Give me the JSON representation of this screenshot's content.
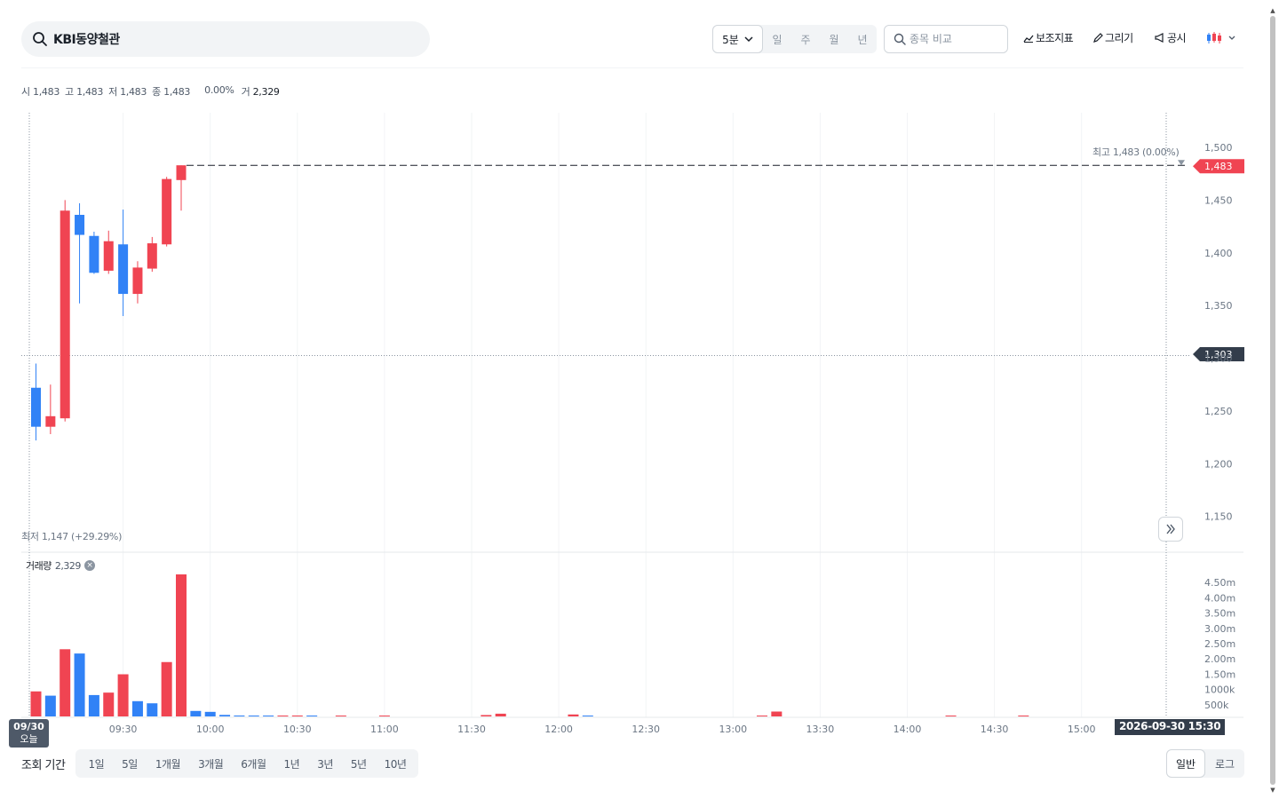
{
  "search": {
    "stock_name": "KBI동양철관"
  },
  "toolbar": {
    "interval_selected": "5분",
    "interval_options": [
      "일",
      "주",
      "월",
      "년"
    ],
    "compare_placeholder": "종목 비교",
    "indicator_label": "보조지표",
    "draw_label": "그리기",
    "disclosure_label": "공시"
  },
  "ohlc": {
    "open_label": "시",
    "open": "1,483",
    "high_label": "고",
    "high": "1,483",
    "low_label": "저",
    "low": "1,483",
    "close_label": "종",
    "close": "1,483",
    "change": "0.00%",
    "volume_label": "거",
    "volume": "2,329"
  },
  "annotations": {
    "high_text": "최고  1,483 (0.00%)",
    "low_text": "최저  1,147 (+29.29%)",
    "current_price_tag": "1,483",
    "crosshair_price_tag": "1,303"
  },
  "volume_panel": {
    "label": "거래량",
    "value": "2,329"
  },
  "date_badge": {
    "date": "09/30",
    "day": "오늘"
  },
  "timestamp_badge": "2026-09-30 15:30",
  "period": {
    "label": "조회 기간",
    "options": [
      "1일",
      "5일",
      "1개월",
      "3개월",
      "6개월",
      "1년",
      "3년",
      "5년",
      "10년"
    ]
  },
  "scale": {
    "normal": "일반",
    "log": "로그"
  },
  "colors": {
    "up": "#f04452",
    "down": "#3182f6",
    "grid": "#f2f4f6",
    "tag_bg": "#333d4b"
  },
  "chart_data": [
    {
      "type": "candlestick",
      "xlabel": "",
      "ylabel": "",
      "y_ticks": [
        1150,
        1200,
        1250,
        1300,
        1350,
        1400,
        1450,
        1500
      ],
      "y_tick_labels": [
        "1,150",
        "1,200",
        "1,250",
        "1,300",
        "1,350",
        "1,400",
        "1,450",
        "1,500"
      ],
      "x_tick_labels": [
        "09:30",
        "10:00",
        "10:30",
        "11:00",
        "11:30",
        "12:00",
        "12:30",
        "13:00",
        "13:30",
        "14:00",
        "14:30",
        "15:00"
      ],
      "ylim": [
        1120,
        1515
      ],
      "grid": true,
      "candles": [
        {
          "time": "09:00",
          "open": 1272,
          "high": 1295,
          "low": 1222,
          "close": 1235
        },
        {
          "time": "09:05",
          "open": 1235,
          "high": 1275,
          "low": 1228,
          "close": 1245
        },
        {
          "time": "09:10",
          "open": 1243,
          "high": 1450,
          "low": 1240,
          "close": 1440
        },
        {
          "time": "09:15",
          "open": 1436,
          "high": 1447,
          "low": 1352,
          "close": 1417
        },
        {
          "time": "09:20",
          "open": 1416,
          "high": 1420,
          "low": 1380,
          "close": 1381
        },
        {
          "time": "09:25",
          "open": 1383,
          "high": 1421,
          "low": 1380,
          "close": 1411
        },
        {
          "time": "09:30",
          "open": 1408,
          "high": 1441,
          "low": 1340,
          "close": 1361
        },
        {
          "time": "09:35",
          "open": 1361,
          "high": 1392,
          "low": 1352,
          "close": 1386
        },
        {
          "time": "09:40",
          "open": 1385,
          "high": 1415,
          "low": 1382,
          "close": 1409
        },
        {
          "time": "09:45",
          "open": 1408,
          "high": 1472,
          "low": 1406,
          "close": 1470
        },
        {
          "time": "09:50",
          "open": 1469,
          "high": 1483,
          "low": 1440,
          "close": 1483
        }
      ],
      "last_price": 1483,
      "high": 1483,
      "low": 1147
    },
    {
      "type": "bar",
      "title": "거래량",
      "y_tick_labels": [
        "500k",
        "1000k",
        "1.50m",
        "2.00m",
        "2.50m",
        "3.00m",
        "3.50m",
        "4.00m",
        "4.50m"
      ],
      "y_ticks": [
        500000,
        1000000,
        1500000,
        2000000,
        2500000,
        3000000,
        3500000,
        4000000,
        4500000
      ],
      "ylim": [
        0,
        4700000
      ],
      "bars": [
        {
          "time": "09:00",
          "value": 820000,
          "direction": "up"
        },
        {
          "time": "09:05",
          "value": 680000,
          "direction": "down"
        },
        {
          "time": "09:10",
          "value": 2200000,
          "direction": "up"
        },
        {
          "time": "09:15",
          "value": 2060000,
          "direction": "down"
        },
        {
          "time": "09:20",
          "value": 700000,
          "direction": "down"
        },
        {
          "time": "09:25",
          "value": 780000,
          "direction": "up"
        },
        {
          "time": "09:30",
          "value": 1380000,
          "direction": "up"
        },
        {
          "time": "09:35",
          "value": 500000,
          "direction": "down"
        },
        {
          "time": "09:40",
          "value": 430000,
          "direction": "down"
        },
        {
          "time": "09:45",
          "value": 1780000,
          "direction": "up"
        },
        {
          "time": "09:50",
          "value": 4650000,
          "direction": "up"
        },
        {
          "time": "09:55",
          "value": 180000,
          "direction": "down"
        },
        {
          "time": "10:00",
          "value": 150000,
          "direction": "down"
        },
        {
          "time": "10:05",
          "value": 50000,
          "direction": "down"
        },
        {
          "time": "10:10",
          "value": 30000,
          "direction": "down"
        },
        {
          "time": "10:15",
          "value": 25000,
          "direction": "down"
        },
        {
          "time": "10:20",
          "value": 20000,
          "direction": "down"
        },
        {
          "time": "10:25",
          "value": 25000,
          "direction": "up"
        },
        {
          "time": "10:30",
          "value": 30000,
          "direction": "up"
        },
        {
          "time": "10:35",
          "value": 20000,
          "direction": "down"
        },
        {
          "time": "10:45",
          "value": 25000,
          "direction": "up"
        },
        {
          "time": "11:00",
          "value": 20000,
          "direction": "up"
        },
        {
          "time": "11:35",
          "value": 45000,
          "direction": "up"
        },
        {
          "time": "11:40",
          "value": 90000,
          "direction": "up"
        },
        {
          "time": "12:05",
          "value": 65000,
          "direction": "up"
        },
        {
          "time": "12:10",
          "value": 25000,
          "direction": "down"
        },
        {
          "time": "13:10",
          "value": 25000,
          "direction": "up"
        },
        {
          "time": "13:15",
          "value": 160000,
          "direction": "up"
        },
        {
          "time": "14:15",
          "value": 20000,
          "direction": "up"
        },
        {
          "time": "14:40",
          "value": 20000,
          "direction": "up"
        }
      ]
    }
  ]
}
